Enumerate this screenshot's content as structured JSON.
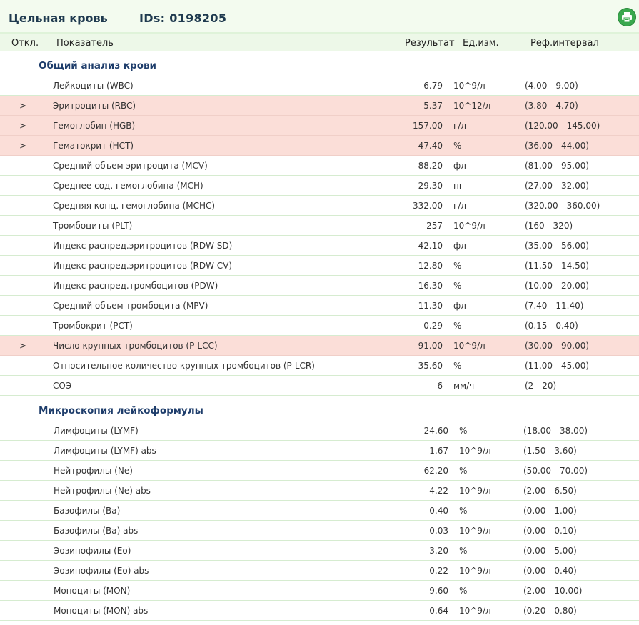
{
  "header": {
    "title": "Цельная кровь",
    "ids": "IDs: 0198205"
  },
  "columns": {
    "flag": "Откл.",
    "indicator": "Показатель",
    "result": "Результат",
    "unit": "Ед.изм.",
    "ref": "Реф.интервал"
  },
  "sections": [
    {
      "title": "Общий анализ крови",
      "rows": [
        {
          "mark": "",
          "name": "Лейкоциты (WBC)",
          "value": "6.79",
          "unit": "10^9/л",
          "ref": "(4.00 - 9.00)"
        },
        {
          "mark": ">",
          "name": "Эритроциты (RBC)",
          "value": "5.37",
          "unit": "10^12/л",
          "ref": "(3.80 - 4.70)"
        },
        {
          "mark": ">",
          "name": "Гемоглобин (HGB)",
          "value": "157.00",
          "unit": "г/л",
          "ref": "(120.00 - 145.00)"
        },
        {
          "mark": ">",
          "name": "Гематокрит (HCT)",
          "value": "47.40",
          "unit": "%",
          "ref": "(36.00 - 44.00)"
        },
        {
          "mark": "",
          "name": "Средний объем эритроцита (MCV)",
          "value": "88.20",
          "unit": "фл",
          "ref": "(81.00 - 95.00)"
        },
        {
          "mark": "",
          "name": "Среднее сод. гемоглобина (MCH)",
          "value": "29.30",
          "unit": "пг",
          "ref": "(27.00 - 32.00)"
        },
        {
          "mark": "",
          "name": "Средняя конц. гемоглобина (MCHC)",
          "value": "332.00",
          "unit": "г/л",
          "ref": "(320.00 - 360.00)"
        },
        {
          "mark": "",
          "name": "Тромбоциты (PLT)",
          "value": "257",
          "unit": "10^9/л",
          "ref": "(160 - 320)"
        },
        {
          "mark": "",
          "name": "Индекс распред.эритроцитов (RDW-SD)",
          "value": "42.10",
          "unit": "фл",
          "ref": "(35.00 - 56.00)"
        },
        {
          "mark": "",
          "name": "Индекс распред.эритроцитов (RDW-CV)",
          "value": "12.80",
          "unit": "%",
          "ref": "(11.50 - 14.50)"
        },
        {
          "mark": "",
          "name": "Индекс распред.тромбоцитов (PDW)",
          "value": "16.30",
          "unit": "%",
          "ref": "(10.00 - 20.00)"
        },
        {
          "mark": "",
          "name": "Средний объем тромбоцита (MPV)",
          "value": "11.30",
          "unit": "фл",
          "ref": "(7.40 - 11.40)"
        },
        {
          "mark": "",
          "name": "Тромбокрит (PCT)",
          "value": "0.29",
          "unit": "%",
          "ref": "(0.15 - 0.40)"
        },
        {
          "mark": ">",
          "name": "Число крупных тромбоцитов (P-LCC)",
          "value": "91.00",
          "unit": "10^9/л",
          "ref": "(30.00 - 90.00)"
        },
        {
          "mark": "",
          "name": "Относительное количество крупных тромбоцитов (P-LCR)",
          "value": "35.60",
          "unit": "%",
          "ref": "(11.00 - 45.00)"
        },
        {
          "mark": "",
          "name": "СОЭ",
          "value": "6",
          "unit": "мм/ч",
          "ref": "(2 - 20)"
        }
      ]
    },
    {
      "title": "Микроскопия лейкоформулы",
      "rows": [
        {
          "mark": "",
          "name": "Лимфоциты (LYMF)",
          "value": "24.60",
          "unit": "%",
          "ref": "(18.00 - 38.00)"
        },
        {
          "mark": "",
          "name": "Лимфоциты (LYMF) abs",
          "value": "1.67",
          "unit": "10^9/л",
          "ref": "(1.50 - 3.60)"
        },
        {
          "mark": "",
          "name": "Нейтрофилы (Ne)",
          "value": "62.20",
          "unit": "%",
          "ref": "(50.00 - 70.00)"
        },
        {
          "mark": "",
          "name": "Нейтрофилы (Ne) abs",
          "value": "4.22",
          "unit": "10^9/л",
          "ref": "(2.00 - 6.50)"
        },
        {
          "mark": "",
          "name": "Базофилы (Ba)",
          "value": "0.40",
          "unit": "%",
          "ref": "(0.00 - 1.00)"
        },
        {
          "mark": "",
          "name": "Базофилы (Ba) abs",
          "value": "0.03",
          "unit": "10^9/л",
          "ref": "(0.00 - 0.10)"
        },
        {
          "mark": "",
          "name": "Эозинофилы (Eo)",
          "value": "3.20",
          "unit": "%",
          "ref": "(0.00 - 5.00)"
        },
        {
          "mark": "",
          "name": "Эозинофилы (Eo) abs",
          "value": "0.22",
          "unit": "10^9/л",
          "ref": "(0.00 - 0.40)"
        },
        {
          "mark": "",
          "name": "Моноциты (MON)",
          "value": "9.60",
          "unit": "%",
          "ref": "(2.00 - 10.00)"
        },
        {
          "mark": "",
          "name": "Моноциты (MON) abs",
          "value": "0.64",
          "unit": "10^9/л",
          "ref": "(0.20 - 0.80)"
        }
      ]
    }
  ]
}
